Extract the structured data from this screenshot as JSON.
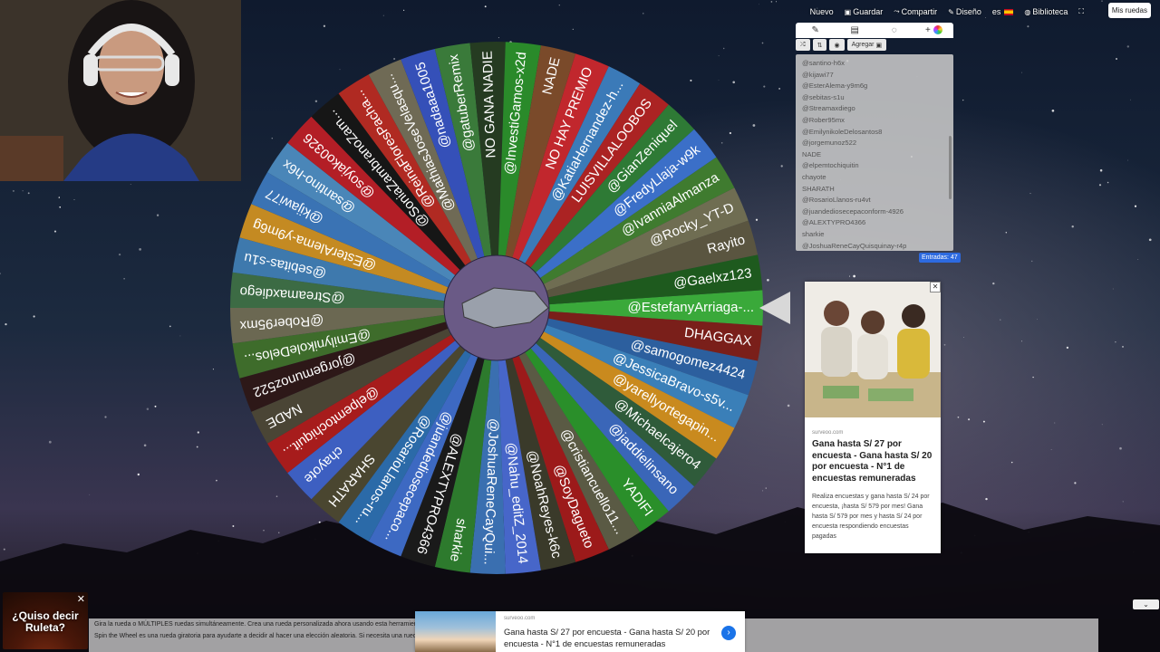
{
  "nav": {
    "nuevo": "Nuevo",
    "guardar": "Guardar",
    "compartir": "Compartir",
    "diseno": "Diseño",
    "language": "es",
    "biblioteca": "Biblioteca",
    "mis_ruedas": "Mis ruedas"
  },
  "panel": {
    "agregar": "Agregar",
    "count_label": "Entradas: 47",
    "visible_entries": [
      "@santino-h6x",
      "@kijawi77",
      "@EsterAlema-y9m6g",
      "@sebitas-s1u",
      "@Streamaxdiego",
      "@Rober95mx",
      "@EmilynikoleDelosantos8",
      "@jorgemunoz522",
      "NADE",
      "@elpemtochiquitin",
      "chayote",
      "SHARATH",
      "@RosarioLlanos-ru4vt",
      "@juandediosecepaconform-4926",
      "@ALEXTYPRO4366",
      "sharkie",
      "@JoshuaReneCayQuisquinay-r4p"
    ]
  },
  "wheel": {
    "labels": [
      "@EstefanyArriaga-...",
      "DHAGGAX",
      "@samogomez4424",
      "@JessicaBravo-s5v...",
      "@yarellyortegapin...",
      "@Michaelcajero4",
      "@jaddielinsano",
      "YADIFI",
      "@cristiancuello11...",
      "@SoyDagueto",
      "@NoahReyes-k6c",
      "@Nahu_editZ_2014",
      "@JoshuaReneCayQui...",
      "sharkie",
      "@ALEXTYPRO4366",
      "@juandediosecepaco...",
      "@RosarioLlanos-ru...",
      "SHARATH",
      "chayote",
      "@elpemtochiquit...",
      "NADE",
      "@jorgemunoz522",
      "@EmilynikoleDelos...",
      "@Rober95mx",
      "@Streamaxdiego",
      "@sebitas-s1u",
      "@EsterAlema-y9m6g",
      "@kijawi77",
      "@santino-h6x",
      "@soyjako0326",
      "@SoniaZambranoZam...",
      "@ReinaFloresPacha...",
      "@MathiasJoseVelasqu...",
      "@nadaaa1005",
      "@gatuberRemix",
      "NO GANA NADIE",
      "@InvestiGamos-x2d",
      "NADE",
      "NO HAY PREMIO",
      "@KatiaHernandez-h...",
      "LUISVILLALOOBOS",
      "@GianZeniquel",
      "@FredyLlaja-w9k",
      "@IvanniaAlmanza",
      "@Rocky_YT-D",
      "Rayito",
      "@Gaelxz123"
    ],
    "colors": [
      "#3aa93a",
      "#7a1f1a",
      "#2c5f9e",
      "#3a7fb8",
      "#c98a1e",
      "#2f5b3a",
      "#3a66b8",
      "#2a8f2a",
      "#5a5a44",
      "#9c1a1a",
      "#3a3a2a",
      "#4766c9",
      "#3a6fb0",
      "#2d7a2d",
      "#1a1a1a",
      "#3d69c2",
      "#2b6aa8",
      "#4a4630",
      "#3d5fc1",
      "#a71c1c",
      "#4a4535",
      "#2d1818",
      "#3e6c2b",
      "#6b6852",
      "#3c6b44",
      "#3e79ad",
      "#c48a22",
      "#3a73b4",
      "#4a86b8",
      "#b31e26",
      "#161616",
      "#b02a22",
      "#6f6a55",
      "#3550b8",
      "#3a7a3a",
      "#253b21",
      "#2a8a2a",
      "#7a4a2a",
      "#c1272d",
      "#3b7ab8",
      "#ab2323",
      "#2e7a35",
      "#3b6fc8",
      "#3f7b2f",
      "#6f6d52",
      "#5a5540",
      "#1e5a1e"
    ],
    "arrow_color": "#d8d8d8"
  },
  "ad_card": {
    "source": "surveoo.com",
    "title": "Gana hasta S/ 27 por encuesta - Gana hasta S/ 20 por encuesta - N°1 de encuestas remuneradas",
    "description": "Realiza encuestas y gana hasta S/ 24 por encuesta, ¡hasta S/ 579 por mes! Gana hasta S/ 579 por mes y hasta S/ 24 por encuesta respondiendo encuestas pagadas"
  },
  "bottom_ad": {
    "source": "surveoo.com",
    "title": "Gana hasta S/ 27 por encuesta - Gana hasta S/ 20 por encuesta - N°1 de encuestas remuneradas"
  },
  "bottom_text": {
    "line1": "Gira la rueda o MÚLTIPLES ruedas simultáneamente. Crea una rueda personalizada ahora usando esta herramienta",
    "line2": "Spin the Wheel es una rueda giratoria para ayudarte a decidir al hacer una elección aleatoria. Si necesita una rueda de la fortuna para juegos o una simple rueda sí o no, simplemente gira la rueda para obtener tu decisión."
  },
  "quiso": {
    "text": "¿Quiso decir Ruleta?"
  }
}
